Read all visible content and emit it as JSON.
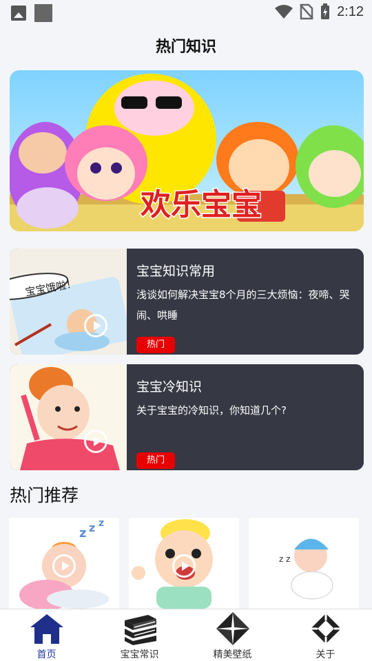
{
  "status_bar": {
    "time": "2:12"
  },
  "header": {
    "title": "热门知识"
  },
  "banner": {
    "caption": "欢乐宝宝"
  },
  "articles": [
    {
      "title": "宝宝知识常用",
      "description": "浅谈如何解决宝宝8个月的三大烦恼：夜啼、哭闹、哄睡",
      "tag": "热门",
      "thumb_text": "宝宝饿啦！"
    },
    {
      "title": "宝宝冷知识",
      "description": "关于宝宝的冷知识，你知道几个?",
      "tag": "热门"
    }
  ],
  "recommend": {
    "title": "热门推荐"
  },
  "nav": {
    "items": [
      {
        "label": "首页",
        "icon": "home-icon",
        "active": true
      },
      {
        "label": "宝宝常识",
        "icon": "books-icon"
      },
      {
        "label": "精美壁纸",
        "icon": "diamond-quadrant-icon"
      },
      {
        "label": "关于",
        "icon": "compass-diamond-icon"
      }
    ]
  },
  "colors": {
    "accent": "#1f3aa0",
    "tag_red": "#e60000",
    "panel": "#343642"
  }
}
